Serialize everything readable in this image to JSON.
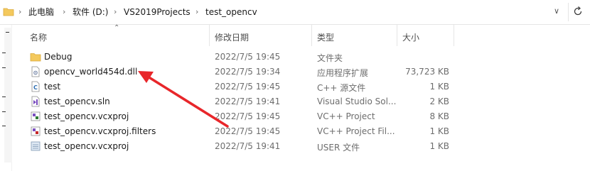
{
  "address_bar": {
    "crumbs": [
      "此电脑",
      "软件 (D:)",
      "VS2019Projects",
      "test_opencv"
    ]
  },
  "columns": {
    "name": "名称",
    "date": "修改日期",
    "type": "类型",
    "size": "大小"
  },
  "files": [
    {
      "name": "Debug",
      "date": "2022/7/5 19:45",
      "type": "文件夹",
      "size": "",
      "icon": "folder-icon"
    },
    {
      "name": "opencv_world454d.dll",
      "date": "2022/7/5 19:34",
      "type": "应用程序扩展",
      "size": "73,723 KB",
      "icon": "dll-file-icon"
    },
    {
      "name": "test",
      "date": "2022/7/5 19:45",
      "type": "C++ 源文件",
      "size": "1 KB",
      "icon": "cpp-file-icon"
    },
    {
      "name": "test_opencv.sln",
      "date": "2022/7/5 19:41",
      "type": "Visual Studio Sol...",
      "size": "2 KB",
      "icon": "sln-file-icon"
    },
    {
      "name": "test_opencv.vcxproj",
      "date": "2022/7/5 19:45",
      "type": "VC++ Project",
      "size": "8 KB",
      "icon": "vcxproj-file-icon"
    },
    {
      "name": "test_opencv.vcxproj.filters",
      "date": "2022/7/5 19:45",
      "type": "VC++ Project Fil...",
      "size": "1 KB",
      "icon": "filters-file-icon"
    },
    {
      "name": "test_opencv.vcxproj",
      "date": "2022/7/5 19:41",
      "type": "USER 文件",
      "size": "1 KB",
      "icon": "user-file-icon"
    }
  ],
  "colors": {
    "annotation_arrow": "#e8262a",
    "folder": "#f4c95d"
  }
}
